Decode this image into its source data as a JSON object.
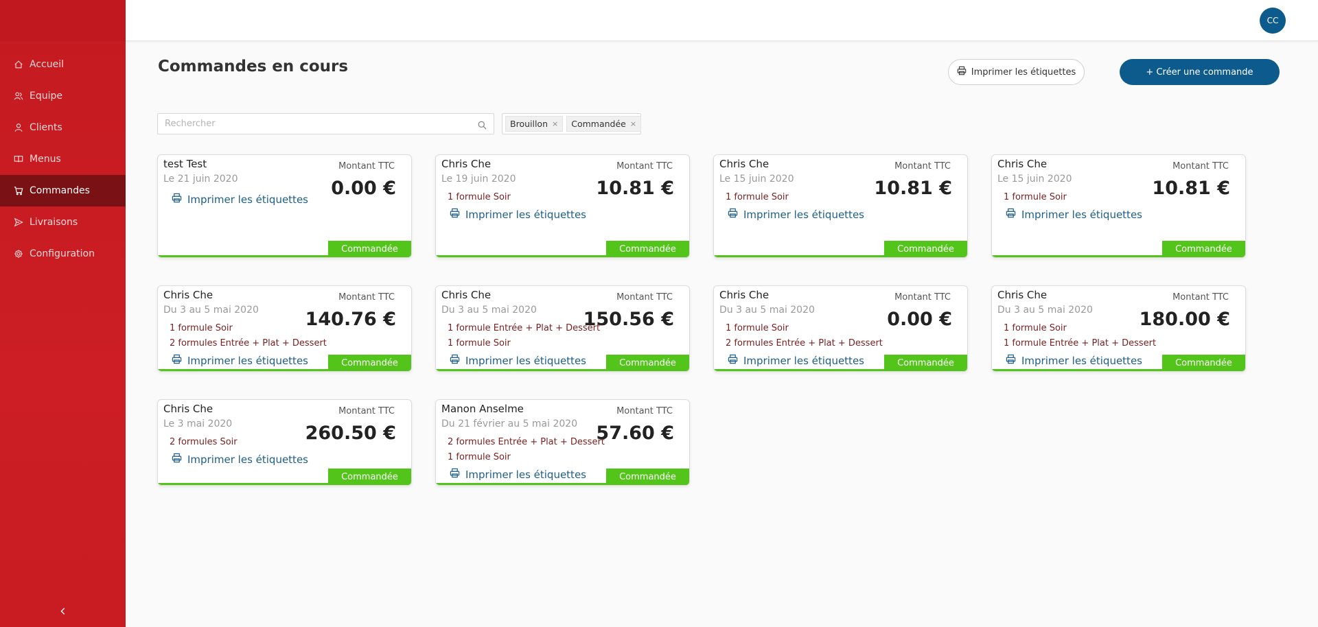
{
  "sidebar": {
    "items": [
      {
        "label": "Accueil",
        "icon": "home-icon"
      },
      {
        "label": "Equipe",
        "icon": "team-icon"
      },
      {
        "label": "Clients",
        "icon": "user-icon"
      },
      {
        "label": "Menus",
        "icon": "book-icon"
      },
      {
        "label": "Commandes",
        "icon": "cart-icon",
        "active": true
      },
      {
        "label": "Livraisons",
        "icon": "send-icon"
      },
      {
        "label": "Configuration",
        "icon": "gear-icon"
      }
    ],
    "collapse_icon": "chevron-left-icon"
  },
  "topbar": {
    "avatar_initials": "CC"
  },
  "header": {
    "title": "Commandes en cours",
    "print_labels_button": "Imprimer les étiquettes",
    "create_order_button": "+ Créer une commande"
  },
  "filters": {
    "search_placeholder": "Rechercher",
    "status_tags": [
      "Brouillon",
      "Commandée"
    ],
    "tag_remove_glyph": "×"
  },
  "cards": [
    {
      "name": "test Test",
      "date": "Le 21 juin 2020",
      "lines": [],
      "amount_label": "Montant TTC",
      "amount": "0.00 €",
      "print_label": "Imprimer les étiquettes",
      "status": "Commandée"
    },
    {
      "name": "Chris Che",
      "date": "Le 19 juin 2020",
      "lines": [
        "1 formule Soir"
      ],
      "amount_label": "Montant TTC",
      "amount": "10.81 €",
      "print_label": "Imprimer les étiquettes",
      "status": "Commandée"
    },
    {
      "name": "Chris Che",
      "date": "Le 15 juin 2020",
      "lines": [
        "1 formule Soir"
      ],
      "amount_label": "Montant TTC",
      "amount": "10.81 €",
      "print_label": "Imprimer les étiquettes",
      "status": "Commandée"
    },
    {
      "name": "Chris Che",
      "date": "Le 15 juin 2020",
      "lines": [
        "1 formule Soir"
      ],
      "amount_label": "Montant TTC",
      "amount": "10.81 €",
      "print_label": "Imprimer les étiquettes",
      "status": "Commandée"
    },
    {
      "name": "Chris Che",
      "date": "Du 3 au 5 mai 2020",
      "lines": [
        "1 formule Soir",
        "2 formules Entrée + Plat + Dessert"
      ],
      "amount_label": "Montant TTC",
      "amount": "140.76 €",
      "print_label": "Imprimer les étiquettes",
      "status": "Commandée"
    },
    {
      "name": "Chris Che",
      "date": "Du 3 au 5 mai 2020",
      "lines": [
        "1 formule Entrée + Plat + Dessert",
        "1 formule Soir"
      ],
      "amount_label": "Montant TTC",
      "amount": "150.56 €",
      "print_label": "Imprimer les étiquettes",
      "status": "Commandée"
    },
    {
      "name": "Chris Che",
      "date": "Du 3 au 5 mai 2020",
      "lines": [
        "1 formule Soir",
        "2 formules Entrée + Plat + Dessert"
      ],
      "amount_label": "Montant TTC",
      "amount": "0.00 €",
      "print_label": "Imprimer les étiquettes",
      "status": "Commandée"
    },
    {
      "name": "Chris Che",
      "date": "Du 3 au 5 mai 2020",
      "lines": [
        "1 formule Soir",
        "1 formule Entrée + Plat + Dessert"
      ],
      "amount_label": "Montant TTC",
      "amount": "180.00 €",
      "print_label": "Imprimer les étiquettes",
      "status": "Commandée"
    },
    {
      "name": "Chris Che",
      "date": "Le 3 mai 2020",
      "lines": [
        "2 formules Soir"
      ],
      "amount_label": "Montant TTC",
      "amount": "260.50 €",
      "print_label": "Imprimer les étiquettes",
      "status": "Commandée"
    },
    {
      "name": "Manon Anselme",
      "date": "Du 21 février au 5 mai 2020",
      "lines": [
        "2 formules Entrée + Plat + Dessert",
        "1 formule Soir"
      ],
      "amount_label": "Montant TTC",
      "amount": "57.60 €",
      "print_label": "Imprimer les étiquettes",
      "status": "Commandée"
    }
  ],
  "colors": {
    "sidebar": "#c41a20",
    "sidebar_active": "#7a1114",
    "primary": "#0d5a8c",
    "status_green": "#52c41a",
    "line_text": "#7a1f1f"
  }
}
